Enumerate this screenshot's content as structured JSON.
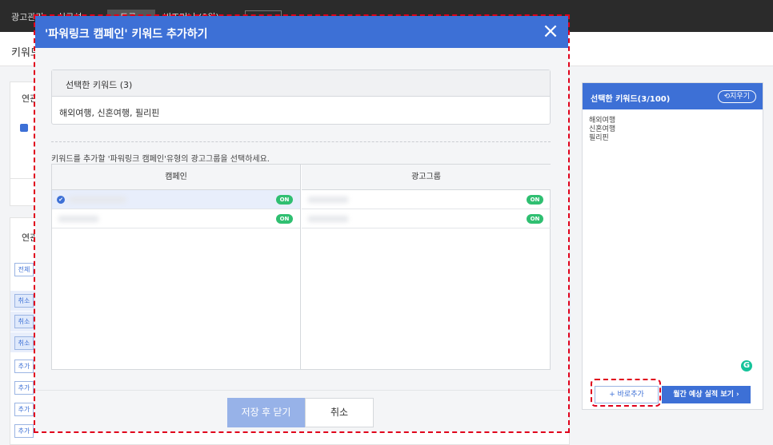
{
  "app": {
    "nav": {
      "item1": "광고관리",
      "item2": "실구성",
      "item3": "도구",
      "item4": "비즈머니 (0원)"
    },
    "page_title": "키워드"
  },
  "background": {
    "panel1_title": "연관",
    "panel2_title": "연관",
    "buttons": [
      {
        "label": "전체",
        "selected": false
      },
      {
        "label": "취소",
        "selected": true
      },
      {
        "label": "취소",
        "selected": true
      },
      {
        "label": "취소",
        "selected": true
      },
      {
        "label": "추가",
        "selected": false
      },
      {
        "label": "추가",
        "selected": false
      },
      {
        "label": "추가",
        "selected": false
      },
      {
        "label": "추가",
        "selected": false
      }
    ]
  },
  "modal": {
    "title": "'파워링크 캠페인' 키워드 추가하기",
    "close_icon": "×",
    "selected_keywords": {
      "title": "선택한 키워드 (3)",
      "content": "해외여행, 신혼여행, 필리핀"
    },
    "instruction": "키워드를 추가할 '파워링크 캠페인'유형의 광고그룹을 선택하세요.",
    "campaign_column": {
      "header": "캠페인",
      "rows": [
        {
          "selected": true,
          "status": "ON"
        },
        {
          "selected": false,
          "status": "ON"
        }
      ]
    },
    "adgroup_column": {
      "header": "광고그룹",
      "rows": [
        {
          "status": "ON"
        },
        {
          "status": "ON"
        }
      ]
    },
    "save_button": "저장 후 닫기",
    "cancel_button": "취소"
  },
  "side_panel": {
    "title": "선택한 키워드(3/100)",
    "clear_button": "⟲지우기",
    "keywords": [
      "해외여행",
      "신혼여행",
      "필리핀"
    ],
    "grammarly_icon": "G",
    "add_now_button": "+ 바로추가",
    "forecast_button": "월간 예상 실적 보기 ›"
  },
  "colors": {
    "primary": "#3d70d6",
    "on_badge": "#2fbf71",
    "highlight": "#e0001b"
  }
}
